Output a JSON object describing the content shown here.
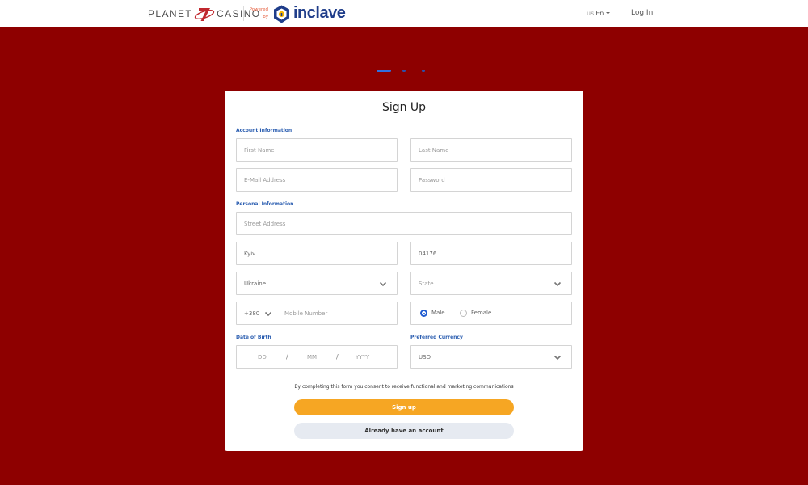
{
  "header": {
    "brand_left": "PLANET",
    "brand_right": "CASINO",
    "powered_line1": "Powered",
    "powered_line2": "by",
    "partner_name": "inclave",
    "language_prefix": "us",
    "language_code": "En",
    "login_label": "Log In"
  },
  "progress": {
    "total_steps": 3,
    "current_step": 1
  },
  "form": {
    "title": "Sign Up",
    "account_section": "Account Information",
    "first_name_placeholder": "First Name",
    "last_name_placeholder": "Last Name",
    "email_placeholder": "E-Mail Address",
    "password_placeholder": "Password",
    "personal_section": "Personal Information",
    "street_placeholder": "Street Address",
    "city_value": "Kyiv",
    "zip_value": "04176",
    "country_value": "Ukraine",
    "state_placeholder": "State",
    "phone_code": "+380",
    "mobile_placeholder": "Mobile Number",
    "gender_options": [
      "Male",
      "Female"
    ],
    "gender_selected": "Male",
    "dob_label": "Date of Birth",
    "dob_day": "DD",
    "dob_month": "MM",
    "dob_year": "YYYY",
    "dob_separator": "/",
    "currency_label": "Preferred Currency",
    "currency_value": "USD",
    "consent_text": "By completing this form you consent to receive functional and marketing communications",
    "signup_button": "Sign up",
    "existing_account_button": "Already have an account"
  },
  "colors": {
    "background": "#8e0000",
    "accent_blue": "#2a5db0",
    "primary_button": "#f6a623",
    "secondary_button": "#e6eaf1",
    "brand_red": "#c0272d",
    "partner_navy": "#1f3d8a"
  },
  "icons": [
    "planet-seven-logo-icon",
    "inclave-shield-icon",
    "chevron-down-icon"
  ]
}
